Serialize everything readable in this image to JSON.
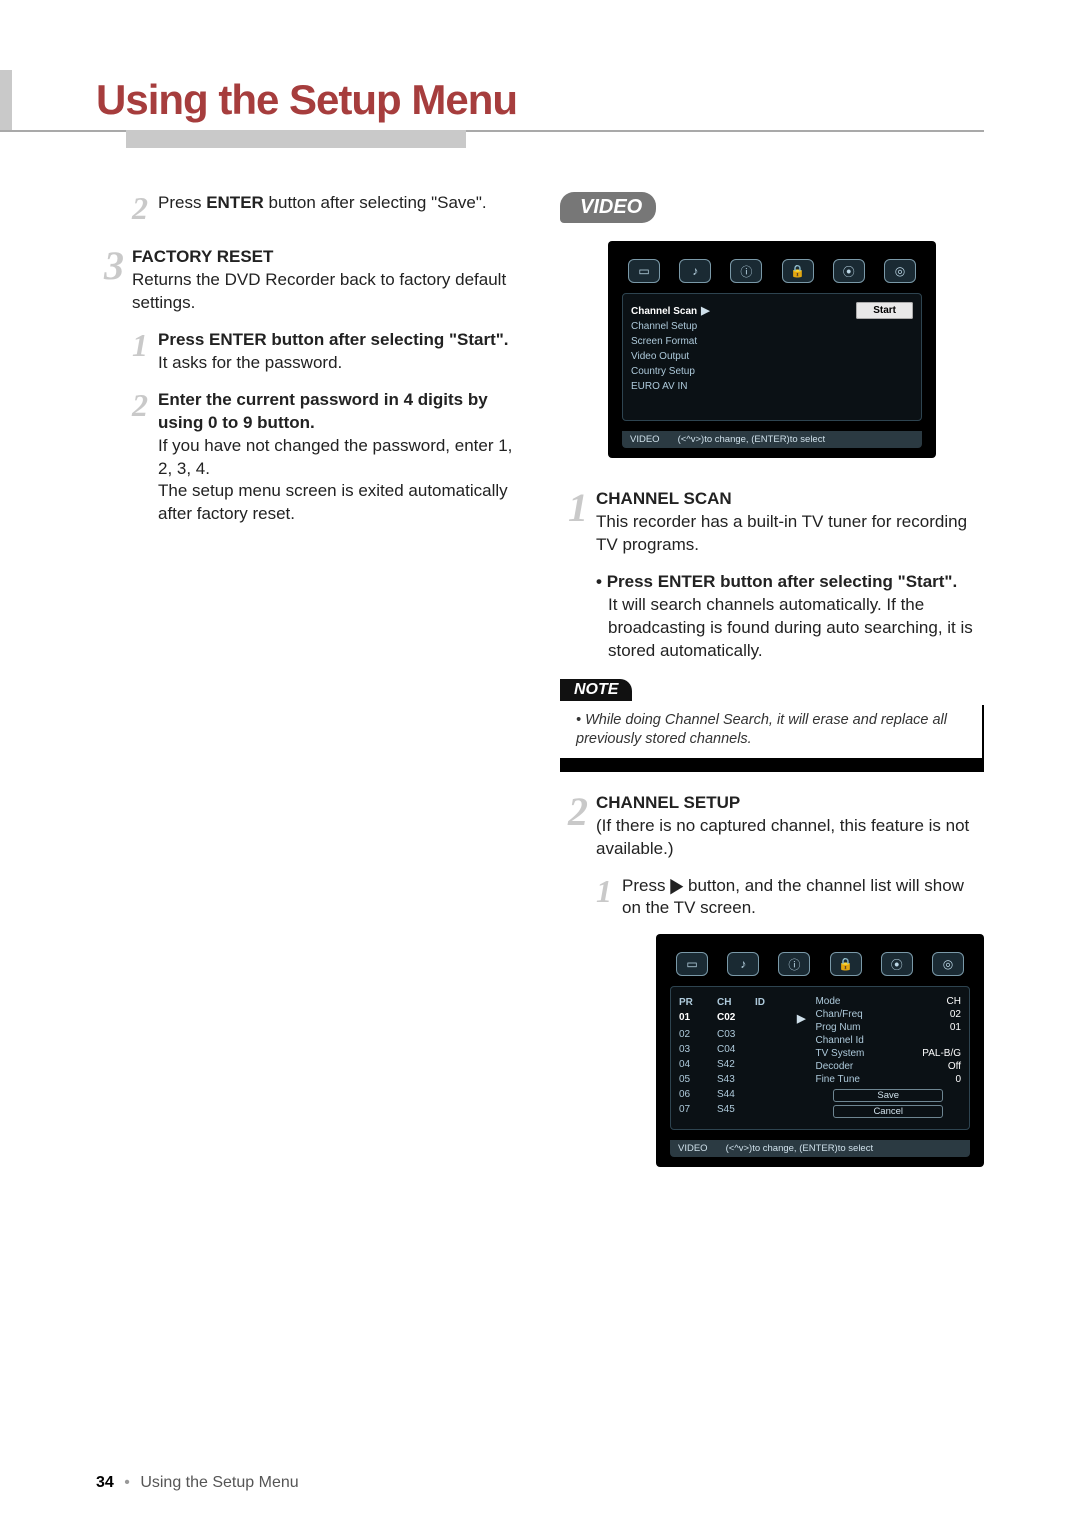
{
  "page": {
    "title": "Using the Setup Menu",
    "number": "34",
    "footer_label": "Using the Setup Menu"
  },
  "left": {
    "step2_num": "2",
    "step2_pre": "Press ",
    "step2_enter": "ENTER",
    "step2_post": " button after selecting \"Save\".",
    "step3_num": "3",
    "step3_title": "FACTORY RESET",
    "step3_body": "Returns the DVD Recorder back to factory default settings.",
    "sub1_num": "1",
    "sub1_title": "Press ENTER button after selecting \"Start\".",
    "sub1_body": "It asks for the password.",
    "sub2_num": "2",
    "sub2_title": "Enter the current password in 4 digits by using 0 to 9 button.",
    "sub2_body_a": "If you have not changed the password, enter 1, 2, 3, 4.",
    "sub2_body_b": "The setup menu screen is exited automatically after factory reset."
  },
  "right": {
    "section": "VIDEO",
    "shot1": {
      "menu": [
        "Channel Scan",
        "Channel Setup",
        "Screen Format",
        "Video Output",
        "Country Setup",
        "EURO AV IN"
      ],
      "selected": 0,
      "button": "Start",
      "footer_left": "VIDEO",
      "footer_right": "(<^v>)to change, (ENTER)to select"
    },
    "s1_num": "1",
    "s1_title": "CHANNEL SCAN",
    "s1_body": "This recorder has a built-in TV tuner for recording TV programs.",
    "s1_bullet_title": "Press ENTER button after selecting \"Start\".",
    "s1_bullet_body": "It will search channels automatically. If the broadcasting is found during auto searching, it is stored automatically.",
    "note_label": "NOTE",
    "note_body": "While doing Channel Search, it will erase and replace all previously stored channels.",
    "s2_num": "2",
    "s2_title": "CHANNEL SETUP",
    "s2_body": "(If there is no captured channel, this feature is not available.)",
    "s2_sub_num": "1",
    "s2_sub_pre": "Press ",
    "s2_sub_post": " button, and the channel list will show on the TV screen.",
    "shot2": {
      "hdr": [
        "PR",
        "CH",
        "ID"
      ],
      "rows": [
        [
          "01",
          "C02",
          ""
        ],
        [
          "02",
          "C03",
          ""
        ],
        [
          "03",
          "C04",
          ""
        ],
        [
          "04",
          "S42",
          ""
        ],
        [
          "05",
          "S43",
          ""
        ],
        [
          "06",
          "S44",
          ""
        ],
        [
          "07",
          "S45",
          ""
        ]
      ],
      "selected": 0,
      "right": [
        [
          "Mode",
          "CH"
        ],
        [
          "Chan/Freq",
          "02"
        ],
        [
          "Prog Num",
          "01"
        ],
        [
          "Channel Id",
          ""
        ],
        [
          "TV System",
          "PAL-B/G"
        ],
        [
          "Decoder",
          "Off"
        ],
        [
          "Fine Tune",
          "0"
        ]
      ],
      "buttons": [
        "Save",
        "Cancel"
      ],
      "footer_left": "VIDEO",
      "footer_right": "(<^v>)to change, (ENTER)to select"
    }
  }
}
